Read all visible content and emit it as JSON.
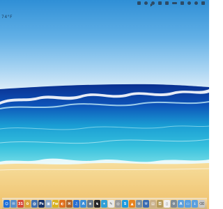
{
  "desktop": {
    "weather_text": "74°F",
    "wallpaper_colors": {
      "sky_top": "#2f8fd6",
      "sky_horizon": "#eef6fc",
      "sea_deep": "#0b3fa8",
      "sea_mid": "#1aa6d6",
      "sea_shallow": "#5ed6e6",
      "sand": "#f3cf86"
    }
  },
  "menubar": {
    "icons": [
      "apps-icon",
      "time-machine-icon",
      "clock-icon",
      "wifi-icon",
      "volume-icon",
      "battery-icon",
      "flag-icon",
      "user-icon",
      "spotlight-icon",
      "list-icon"
    ]
  },
  "dock": {
    "items": [
      {
        "name": "finder-icon",
        "color": "#1e6fd9",
        "glyph": "☺"
      },
      {
        "name": "mail-icon",
        "color": "#5a8fc9",
        "glyph": "✉"
      },
      {
        "name": "calendar-icon",
        "color": "#d64a3a",
        "glyph": "31"
      },
      {
        "name": "photos-icon",
        "color": "#d9a23a",
        "glyph": "✿"
      },
      {
        "name": "mail-app-icon",
        "color": "#3f6fb0",
        "glyph": "@"
      },
      {
        "name": "photoshop-icon",
        "color": "#16336a",
        "glyph": "Ps"
      },
      {
        "name": "iphoto-icon",
        "color": "#8aa7c9",
        "glyph": "▣"
      },
      {
        "name": "fireworks-icon",
        "color": "#d9b21e",
        "glyph": "Fw"
      },
      {
        "name": "firefox-icon",
        "color": "#e0701e",
        "glyph": "◐"
      },
      {
        "name": "preview-icon",
        "color": "#b0642a",
        "glyph": "⌘"
      },
      {
        "name": "itunes-icon",
        "color": "#2a6fd0",
        "glyph": "♫"
      },
      {
        "name": "app-store-icon",
        "color": "#3c8fd8",
        "glyph": "A"
      },
      {
        "name": "network-icon",
        "color": "#6a7a8a",
        "glyph": "⊕"
      },
      {
        "name": "chess-icon",
        "color": "#2a2a2a",
        "glyph": "♞"
      },
      {
        "name": "tweetdeck-icon",
        "color": "#2f9fd8",
        "glyph": "✦"
      },
      {
        "name": "textedit-icon",
        "color": "#e8e8e8",
        "glyph": "✎"
      },
      {
        "name": "grab-icon",
        "color": "#9a9a9a",
        "glyph": "◎"
      },
      {
        "name": "skype-icon",
        "color": "#1e9be0",
        "glyph": "S"
      },
      {
        "name": "vlc-icon",
        "color": "#e7831e",
        "glyph": "▲"
      },
      {
        "name": "utility-icon",
        "color": "#7a8fa0",
        "glyph": "⚙"
      },
      {
        "name": "xcode-icon",
        "color": "#3a6ab0",
        "glyph": "⚒"
      },
      {
        "name": "gallery-icon",
        "color": "#c9b089",
        "glyph": "▤"
      },
      {
        "name": "keychain-icon",
        "color": "#b59a5a",
        "glyph": "⚿"
      },
      {
        "name": "document-icon",
        "color": "#f0f0f0",
        "glyph": "▯"
      },
      {
        "name": "system-prefs-icon",
        "color": "#7c8a96",
        "glyph": "⚙"
      },
      {
        "name": "applications-folder-icon",
        "color": "#5aa0e0",
        "glyph": "A"
      },
      {
        "name": "documents-folder-icon",
        "color": "#5aa0e0",
        "glyph": "▭"
      },
      {
        "name": "downloads-folder-icon",
        "color": "#5aa0e0",
        "glyph": "↓"
      },
      {
        "name": "trash-icon",
        "color": "#c8c8c8",
        "glyph": "⌫"
      }
    ]
  }
}
